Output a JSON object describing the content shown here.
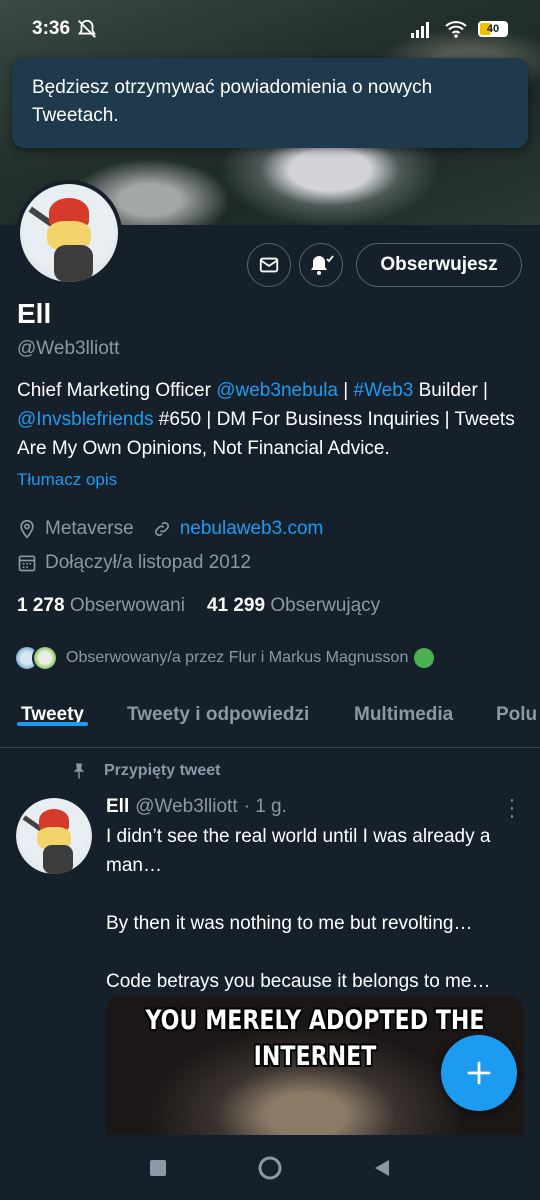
{
  "status": {
    "time": "3:36",
    "battery": "40"
  },
  "toast": {
    "text": "Będziesz otrzymywać powiadomienia o nowych Tweetach."
  },
  "profile": {
    "follow_label": "Obserwujesz",
    "name": "Ell",
    "handle": "@Web3lliott",
    "bio": {
      "p1": "Chief Marketing Officer ",
      "l1": "@web3nebula",
      "p2": " | ",
      "l2": "#Web3",
      "p3": " Builder | ",
      "l3": "@Invsblefriends",
      "p4": " #650 | DM For Business Inquiries | Tweets Are My Own Opinions, Not Financial Advice."
    },
    "translate_label": "Tłumacz opis",
    "location": "Metaverse",
    "website": "nebulaweb3.com",
    "joined": "Dołączył/a listopad 2012",
    "following_count": "1 278",
    "following_label": "Obserwowani",
    "followers_count": "41 299",
    "followers_label": "Obserwujący",
    "followed_by": "Obserwowany/a przez Flur i Markus Magnusson"
  },
  "tabs": [
    {
      "label": "Tweety"
    },
    {
      "label": "Tweety i odpowiedzi"
    },
    {
      "label": "Multimedia"
    },
    {
      "label": "Polu"
    }
  ],
  "tweet": {
    "pinned_label": "Przypięty tweet",
    "author_name": "Ell",
    "author_handle": "@Web3lliott",
    "time": "· 1 g.",
    "text_line1": "I didn’t see the real world until I was already a man…",
    "text_line2": "By then it was nothing to me but revolting…",
    "text_line3": "Code betrays you because it belongs to me…",
    "image_caption": "YOU MERELY ADOPTED THE INTERNET"
  },
  "colors": {
    "background": "#15202b",
    "accent": "#1d9bf0",
    "muted": "#8b98a5"
  }
}
